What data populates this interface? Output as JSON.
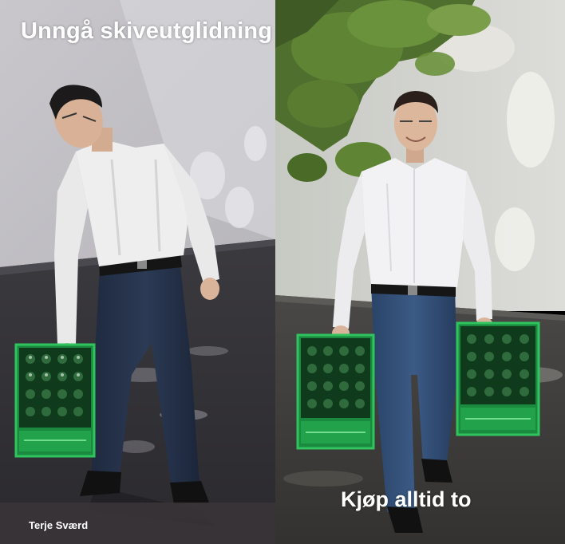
{
  "captions": {
    "top_left": "Unngå skiveutglidning",
    "bottom_right": "Kjøp alltid to"
  },
  "credit": "Terje Sværd",
  "colors": {
    "caption_text": "#ffffff",
    "crate_green": "#1fa84a",
    "shirt_white": "#f2f2f2",
    "jeans_blue": "#2b3f60"
  }
}
